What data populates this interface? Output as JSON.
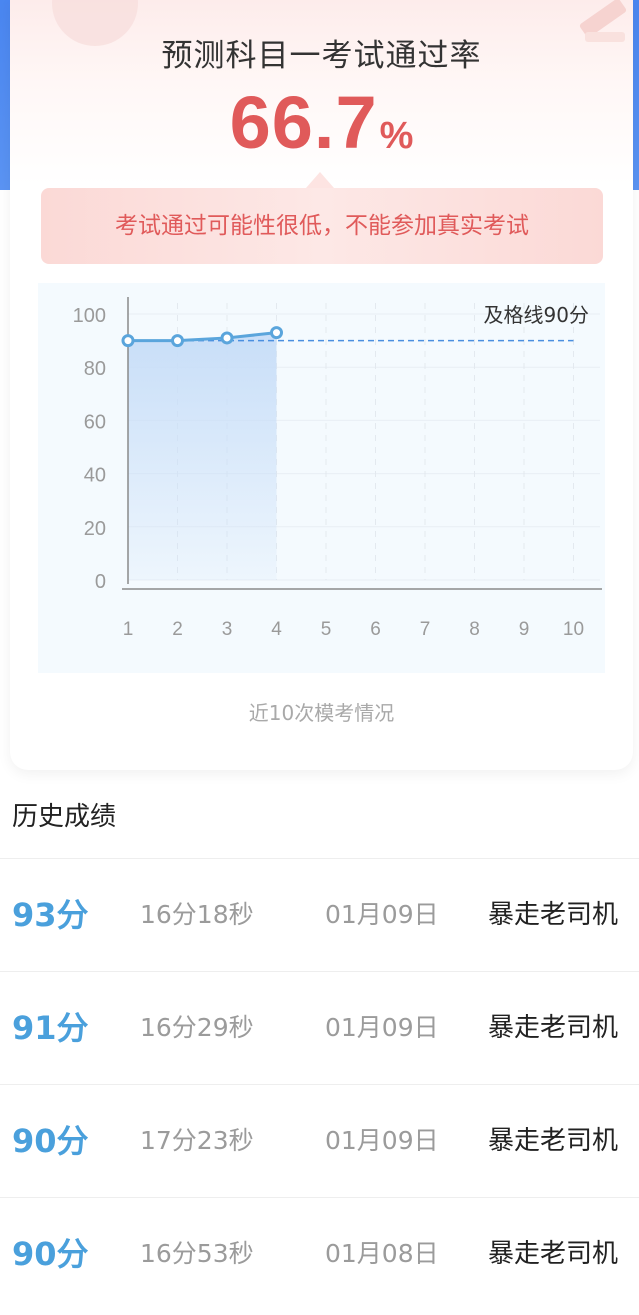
{
  "header": {
    "title": "预测科目一考试通过率",
    "rate_value": "66.7",
    "rate_unit": "%",
    "warning": "考试通过可能性很低，不能参加真实考试"
  },
  "chart_caption": "近10次模考情况",
  "chart_data": {
    "type": "area",
    "x": [
      1,
      2,
      3,
      4,
      5,
      6,
      7,
      8,
      9,
      10
    ],
    "x_tick_labels": [
      "1",
      "2",
      "3",
      "4",
      "5",
      "6",
      "7",
      "8",
      "9",
      "10"
    ],
    "y_tick_labels": [
      "0",
      "20",
      "40",
      "60",
      "80",
      "100"
    ],
    "series": [
      {
        "values": [
          90,
          90,
          91,
          93
        ]
      }
    ],
    "ylim": [
      0,
      100
    ],
    "threshold": {
      "value": 90,
      "label": "及格线90分"
    },
    "grid": true,
    "colors": {
      "line": "#5aa5dc",
      "threshold": "#4a8fe0",
      "fill": "#c8def8"
    }
  },
  "history": {
    "title": "历史成绩",
    "rows": [
      {
        "score": "93分",
        "duration": "16分18秒",
        "date": "01月09日",
        "mode": "暴走老司机"
      },
      {
        "score": "91分",
        "duration": "16分29秒",
        "date": "01月09日",
        "mode": "暴走老司机"
      },
      {
        "score": "90分",
        "duration": "17分23秒",
        "date": "01月09日",
        "mode": "暴走老司机"
      },
      {
        "score": "90分",
        "duration": "16分53秒",
        "date": "01月08日",
        "mode": "暴走老司机"
      }
    ]
  }
}
